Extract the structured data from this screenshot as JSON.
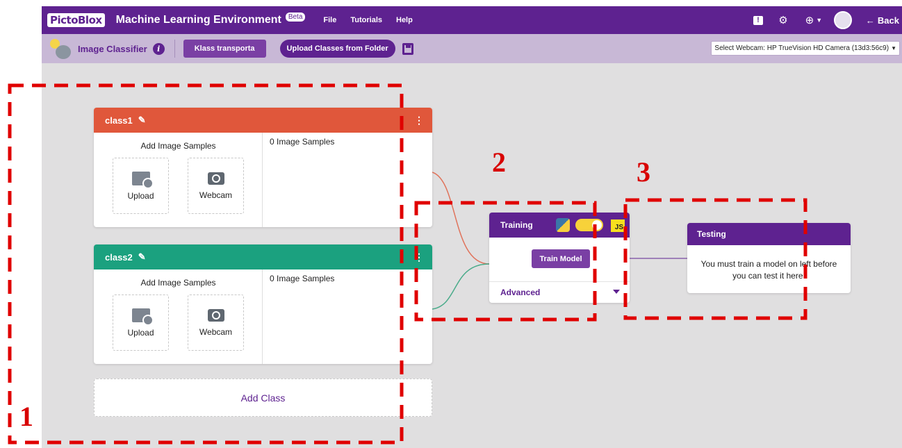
{
  "topbar": {
    "logo": "PictoBlox",
    "title": "Machine Learning Environment",
    "beta": "Beta",
    "menu": [
      "File",
      "Tutorials",
      "Help"
    ],
    "back_label": "Back"
  },
  "subbar": {
    "title": "Image Classifier",
    "project_name": "Klass transporta",
    "upload_folder_label": "Upload Classes from Folder",
    "webcam_select": "Select Webcam:  HP TrueVision HD Camera (13d3:56c9)"
  },
  "classes": [
    {
      "name": "class1",
      "color": "#e0573b",
      "add_samples_label": "Add Image Samples",
      "upload_label": "Upload",
      "webcam_label": "Webcam",
      "samples_count_label": "0 Image Samples"
    },
    {
      "name": "class2",
      "color": "#1ba17f",
      "add_samples_label": "Add Image Samples",
      "upload_label": "Upload",
      "webcam_label": "Webcam",
      "samples_count_label": "0 Image Samples"
    }
  ],
  "add_class_label": "Add Class",
  "training": {
    "title": "Training",
    "js_label": "JS",
    "train_button": "Train Model",
    "advanced_label": "Advanced"
  },
  "testing": {
    "title": "Testing",
    "message": "You must train a model on left before you can test it here."
  },
  "annotations": [
    "1",
    "2",
    "3"
  ],
  "colors": {
    "primary": "#5e2290",
    "annotation": "#e00000",
    "link_class1": "#e0735b",
    "link_class2": "#4aab8a"
  }
}
